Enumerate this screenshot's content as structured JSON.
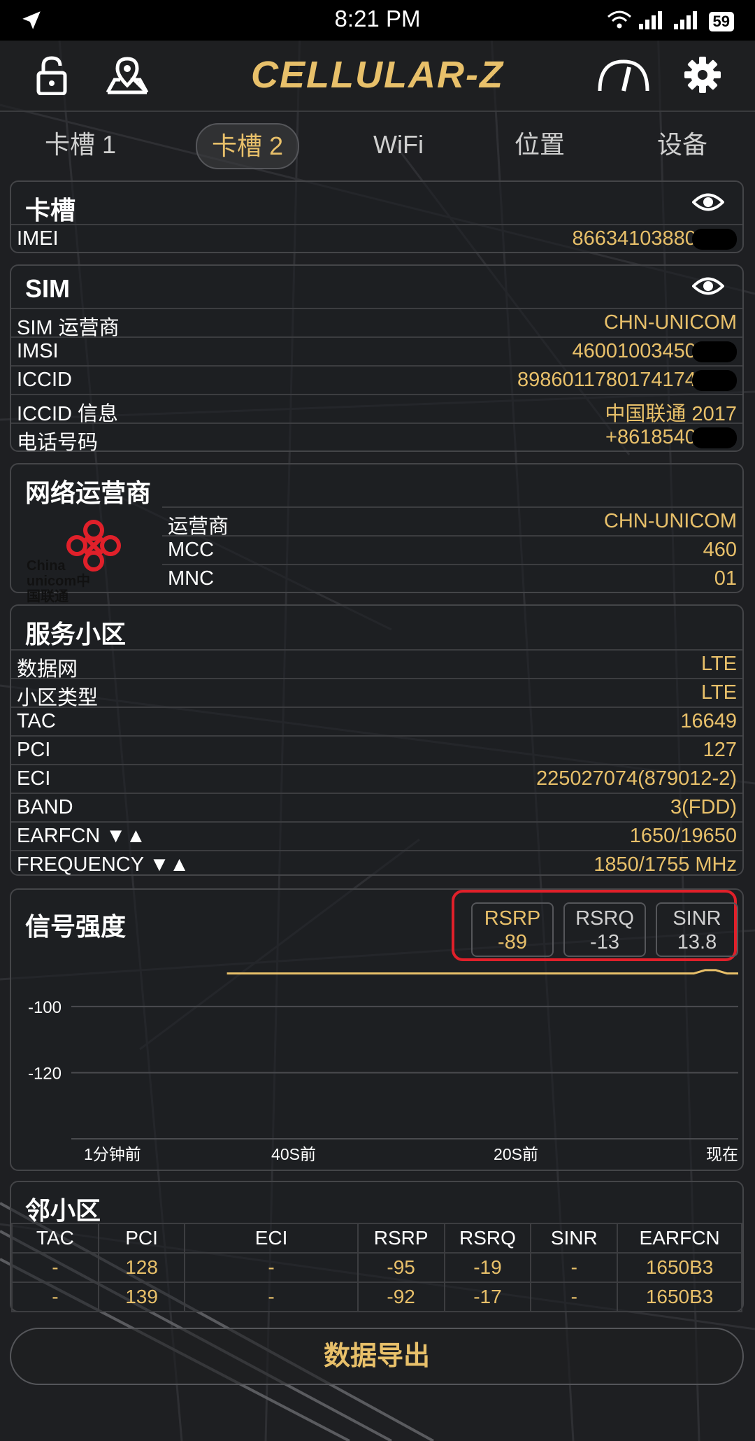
{
  "status_bar": {
    "time": "8:21 PM",
    "battery": "59",
    "icons": [
      "location-arrow-icon",
      "wifi-icon",
      "signal-icon",
      "signal-2-icon"
    ]
  },
  "app_bar": {
    "logo": "CELLULAR-Z",
    "icons": [
      "lock-icon",
      "map-pin-icon",
      "speedometer-icon",
      "gear-icon"
    ]
  },
  "tabs": [
    {
      "label": "卡槽 1",
      "active": false
    },
    {
      "label": "卡槽 2",
      "active": true
    },
    {
      "label": "WiFi",
      "active": false
    },
    {
      "label": "位置",
      "active": false
    },
    {
      "label": "设备",
      "active": false
    }
  ],
  "slot_card": {
    "title": "卡槽",
    "rows": [
      {
        "key": "IMEI",
        "value": "866341038805"
      }
    ]
  },
  "sim_card": {
    "title": "SIM",
    "rows": [
      {
        "key": "SIM 运营商",
        "value": "CHN-UNICOM"
      },
      {
        "key": "IMSI",
        "value": "460010034506"
      },
      {
        "key": "ICCID",
        "value": "89860117801741742"
      },
      {
        "key": "ICCID 信息",
        "value": "中国联通 2017"
      },
      {
        "key": "电话号码",
        "value": "+86185400"
      }
    ]
  },
  "network_card": {
    "title": "网络运营商",
    "logo_text": "China unicom中国联通",
    "rows": [
      {
        "key": "运营商",
        "value": "CHN-UNICOM"
      },
      {
        "key": "MCC",
        "value": "460"
      },
      {
        "key": "MNC",
        "value": "01"
      }
    ]
  },
  "serving_card": {
    "title": "服务小区",
    "rows": [
      {
        "key": "数据网",
        "value": "LTE"
      },
      {
        "key": "小区类型",
        "value": "LTE"
      },
      {
        "key": "TAC",
        "value": "16649"
      },
      {
        "key": "PCI",
        "value": "127"
      },
      {
        "key": "ECI",
        "value": "225027074(879012-2)"
      },
      {
        "key": "BAND",
        "value": "3(FDD)"
      },
      {
        "key": "EARFCN ▼▲",
        "value": "1650/19650"
      },
      {
        "key": "FREQUENCY ▼▲",
        "value": "1850/1755 MHz"
      }
    ]
  },
  "signal_card": {
    "title": "信号强度",
    "metrics": [
      {
        "name": "RSRP",
        "value": "-89",
        "selected": true
      },
      {
        "name": "RSRQ",
        "value": "-13",
        "selected": false
      },
      {
        "name": "SINR",
        "value": "13.8",
        "selected": false
      }
    ],
    "y_ticks": [
      "-100",
      "-120"
    ],
    "x_ticks": [
      "1分钟前",
      "40S前",
      "20S前",
      "现在"
    ],
    "line_color": "#e8c06a"
  },
  "chart_data": {
    "type": "line",
    "title": "信号强度",
    "xlabel": "",
    "ylabel": "",
    "x_ticks": [
      "1分钟前",
      "40S前",
      "20S前",
      "现在"
    ],
    "y_ticks": [
      -100,
      -120
    ],
    "ylim": [
      -140,
      -85
    ],
    "grid": true,
    "series": [
      {
        "x": [
          -46,
          -4,
          -3,
          -2,
          -1,
          0
        ],
        "y": [
          -90,
          -90,
          -89,
          -89,
          -90,
          -90
        ]
      }
    ]
  },
  "neighbor_card": {
    "title": "邻小区",
    "headers": [
      "TAC",
      "PCI",
      "ECI",
      "RSRP",
      "RSRQ",
      "SINR",
      "EARFCN"
    ],
    "rows": [
      [
        "-",
        "128",
        "-",
        "-95",
        "-19",
        "-",
        "1650B3"
      ],
      [
        "-",
        "139",
        "-",
        "-92",
        "-17",
        "-",
        "1650B3"
      ]
    ]
  },
  "export_button": {
    "label": "数据导出"
  },
  "colors": {
    "accent": "#e8c06a",
    "highlight": "#e0202a",
    "background": "#1e1f22"
  }
}
